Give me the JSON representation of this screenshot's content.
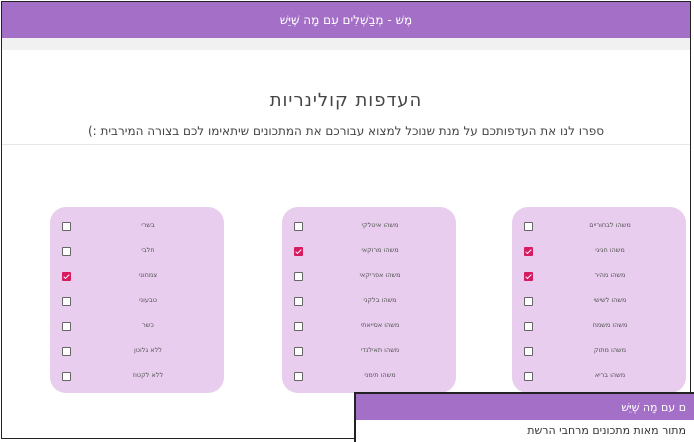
{
  "appbar": {
    "title": "מֶשׁ - מְבַשְּׁלִים עִם מָה שֶּׁיֵּשׁ"
  },
  "header": {
    "title": "העדפות קולינריות",
    "subtitle": "ספרו לנו את העדפותכם על מנת שנוכל למצוא עבורכם את המתכונים שיתאימו לכם בצורה המירבית :)"
  },
  "colors": {
    "brand": "#a36fc7",
    "card": "#e8cdee",
    "checked": "#d81b60"
  },
  "cards": [
    {
      "items": [
        {
          "label": "בשרי",
          "checked": false
        },
        {
          "label": "חלבי",
          "checked": false
        },
        {
          "label": "צמחוני",
          "checked": true
        },
        {
          "label": "טבעוני",
          "checked": false
        },
        {
          "label": "כשר",
          "checked": false
        },
        {
          "label": "ללא גלוטן",
          "checked": false
        },
        {
          "label": "ללא לקטוז",
          "checked": false
        }
      ]
    },
    {
      "items": [
        {
          "label": "משהו איטלקי",
          "checked": false
        },
        {
          "label": "משהו מרוקאי",
          "checked": true
        },
        {
          "label": "משהו אפריקאי",
          "checked": false
        },
        {
          "label": "משהו בלקני",
          "checked": false
        },
        {
          "label": "משהו אסייאתי",
          "checked": false
        },
        {
          "label": "משהו תאילנדי",
          "checked": false
        },
        {
          "label": "משהו תימני",
          "checked": false
        }
      ]
    },
    {
      "items": [
        {
          "label": "משהו לבחוריים",
          "checked": false
        },
        {
          "label": "משהו חגיגי",
          "checked": true
        },
        {
          "label": "משהו מהיר",
          "checked": true
        },
        {
          "label": "משהו לשישי",
          "checked": false
        },
        {
          "label": "משהו משמח",
          "checked": false
        },
        {
          "label": "משהו מתוק",
          "checked": false
        },
        {
          "label": "משהו בריא",
          "checked": false
        }
      ]
    }
  ],
  "popup": {
    "title": "ם עם מָה שֶּׁיֵּשׁ",
    "text": "מתור מאות מתכונים מרחבי הרשת"
  }
}
